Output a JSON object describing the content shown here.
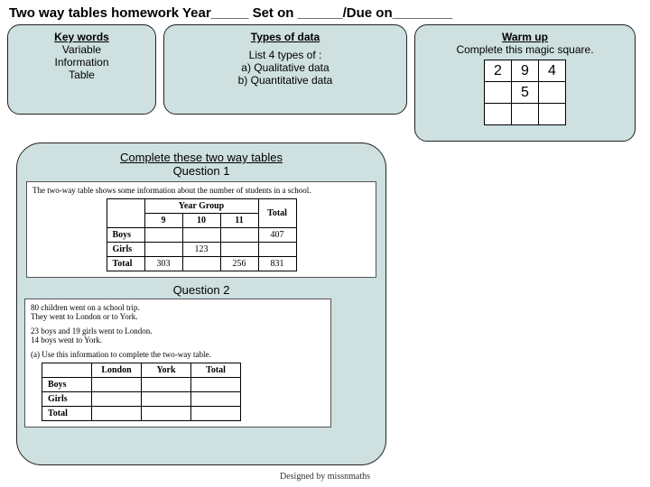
{
  "title": "Two way tables homework Year_____  Set on  ______/Due on________",
  "keywords": {
    "heading": "Key words",
    "items": [
      "Variable",
      "Information",
      "Table"
    ]
  },
  "types": {
    "heading": "Types of data",
    "line1": "List 4 types of :",
    "line2": "a)  Qualitative data",
    "line3": "b)  Quantitative data"
  },
  "warm": {
    "heading": "Warm up",
    "text": "Complete this magic  square.",
    "grid": [
      [
        "2",
        "9",
        "4"
      ],
      [
        "",
        "5",
        ""
      ],
      [
        "",
        "",
        ""
      ]
    ]
  },
  "main": {
    "heading_u": "Complete these two way tables",
    "q1": "Question 1",
    "q1_caption": "The two-way table shows some information about the number of students in a school.",
    "q1_table": {
      "spanHeader": "Year Group",
      "cols": [
        "9",
        "10",
        "11",
        "Total"
      ],
      "rows": [
        [
          "Boys",
          "",
          "",
          "",
          "407"
        ],
        [
          "Girls",
          "",
          "123",
          "",
          ""
        ],
        [
          "Total",
          "303",
          "",
          "256",
          "831"
        ]
      ]
    },
    "q2": "Question 2",
    "q2_lines": [
      "80 children went on a school trip.",
      "They went to London or to York.",
      "",
      "23 boys and 19 girls went to London.",
      "14 boys went to York.",
      "",
      "(a)    Use this information to complete the two-way table."
    ],
    "q2_table": {
      "cols": [
        "London",
        "York",
        "Total"
      ],
      "rows": [
        [
          "Boys",
          "",
          "",
          ""
        ],
        [
          "Girls",
          "",
          "",
          ""
        ],
        [
          "Total",
          "",
          "",
          ""
        ]
      ]
    }
  },
  "footer": "Designed by missnmaths"
}
